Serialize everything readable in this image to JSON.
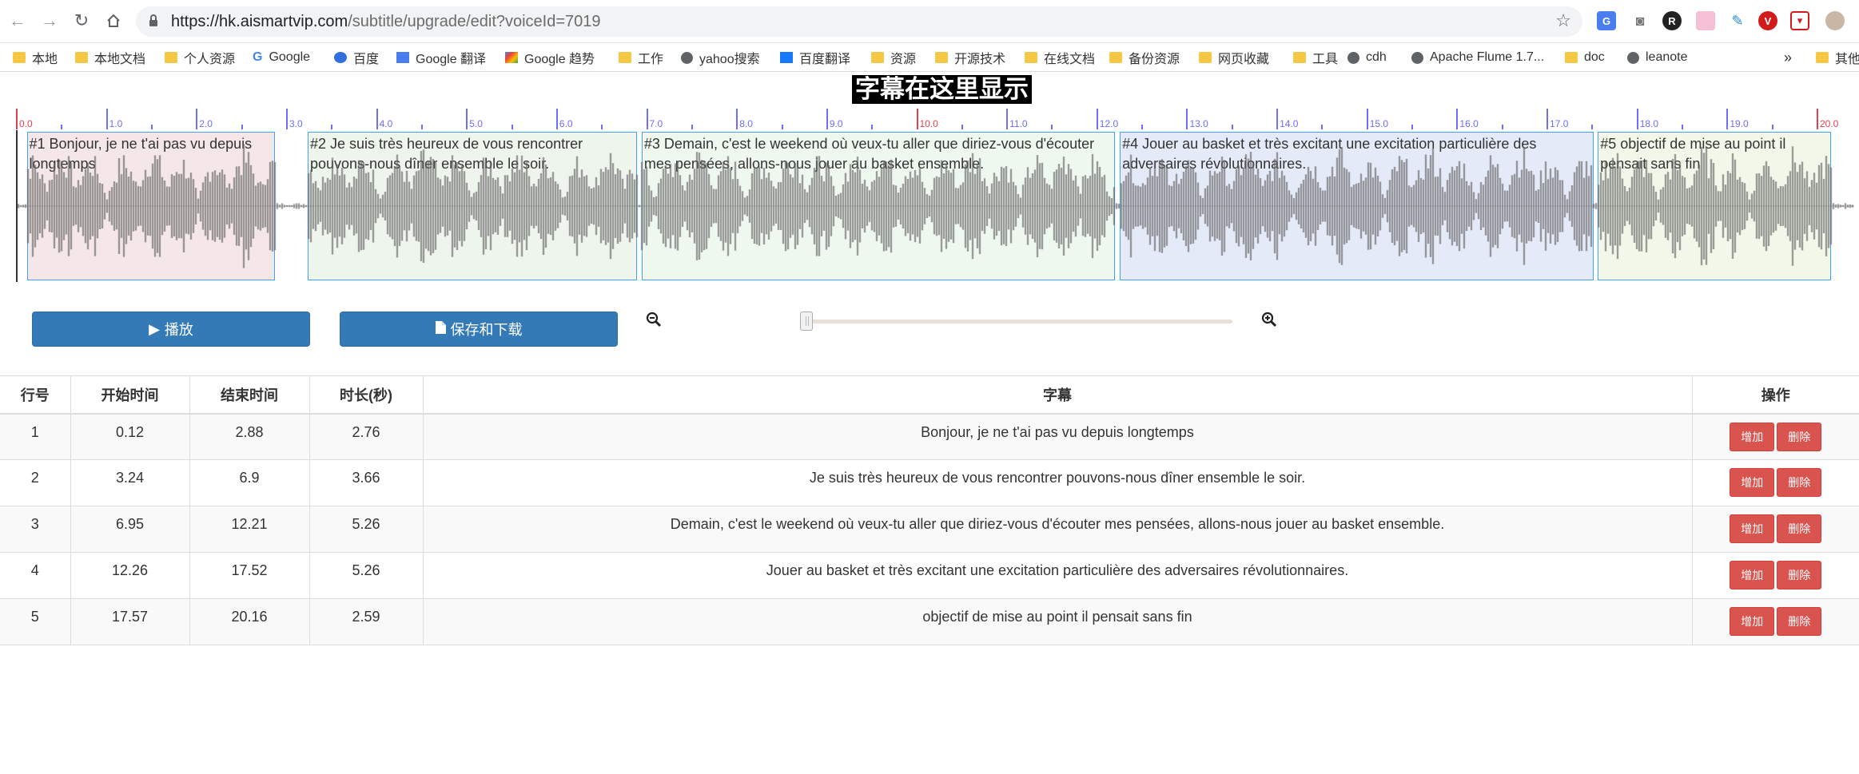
{
  "browser": {
    "url_host": "https://hk.aismartvip.com",
    "url_path": "/subtitle/upgrade/edit?voiceId=7019",
    "bookmarks": [
      {
        "label": "本地",
        "icon": "folder"
      },
      {
        "label": "本地文档",
        "icon": "folder"
      },
      {
        "label": "个人资源",
        "icon": "folder"
      },
      {
        "label": "Google",
        "icon": "google-icon"
      },
      {
        "label": "百度",
        "icon": "baidu-icon"
      },
      {
        "label": "Google 翻译",
        "icon": "translate-icon"
      },
      {
        "label": "Google 趋势",
        "icon": "trends-icon"
      },
      {
        "label": "工作",
        "icon": "folder"
      },
      {
        "label": "yahoo搜索",
        "icon": "globe"
      },
      {
        "label": "百度翻译",
        "icon": "baidu-translate-icon"
      },
      {
        "label": "资源",
        "icon": "folder"
      },
      {
        "label": "开源技术",
        "icon": "folder"
      },
      {
        "label": "在线文档",
        "icon": "folder"
      },
      {
        "label": "备份资源",
        "icon": "folder"
      },
      {
        "label": "网页收藏",
        "icon": "folder"
      },
      {
        "label": "工具",
        "icon": "folder"
      },
      {
        "label": "cdh",
        "icon": "globe"
      },
      {
        "label": "Apache Flume 1.7...",
        "icon": "globe"
      },
      {
        "label": "doc",
        "icon": "folder"
      },
      {
        "label": "leanote",
        "icon": "globe"
      }
    ],
    "overflow_label": "»",
    "other_bookmarks": "其他"
  },
  "player": {
    "subtitle_display": "字幕在这里显示",
    "ticks": [
      "0.0",
      "1.0",
      "2.0",
      "3.0",
      "4.0",
      "5.0",
      "6.0",
      "7.0",
      "8.0",
      "9.0",
      "10.0",
      "11.0",
      "12.0",
      "13.0",
      "14.0",
      "15.0",
      "16.0",
      "17.0",
      "18.0",
      "19.0",
      "20.0"
    ],
    "regions": [
      {
        "label": "#1 Bonjour, je ne t'ai pas vu depuis longtemps",
        "start": 0.12,
        "end": 2.88,
        "color": "#f5e7e7"
      },
      {
        "label": "#2 Je suis très heureux de vous rencontrer pouvons-nous dîner ensemble le soir.",
        "start": 3.24,
        "end": 6.9,
        "color": "#eef5ec"
      },
      {
        "label": "#3 Demain, c'est le weekend où veux-tu aller que diriez-vous d'écouter mes pensées, allons-nous jouer au basket ensemble.",
        "start": 6.95,
        "end": 12.21,
        "color": "#eff8ef"
      },
      {
        "label": "#4 Jouer au basket et très excitant une excitation particulière des adversaires révolutionnaires.",
        "start": 12.26,
        "end": 17.52,
        "color": "#e4eaf8"
      },
      {
        "label": "#5 objectif de mise au point il pensait sans fin",
        "start": 17.57,
        "end": 20.16,
        "color": "#f1f8e9"
      }
    ],
    "play_label": "播放",
    "save_label": "保存和下载",
    "zoom_level": 0.0
  },
  "table": {
    "headers": {
      "row": "行号",
      "start": "开始时间",
      "end": "结束时间",
      "duration": "时长(秒)",
      "subtitle": "字幕",
      "actions": "操作"
    },
    "rows": [
      {
        "no": "1",
        "start": "0.12",
        "end": "2.88",
        "dur": "2.76",
        "text": "Bonjour, je ne t'ai pas vu depuis longtemps"
      },
      {
        "no": "2",
        "start": "3.24",
        "end": "6.9",
        "dur": "3.66",
        "text": "Je suis très heureux de vous rencontrer pouvons-nous dîner ensemble le soir."
      },
      {
        "no": "3",
        "start": "6.95",
        "end": "12.21",
        "dur": "5.26",
        "text": "Demain, c'est le weekend où veux-tu aller que diriez-vous d'écouter mes pensées, allons-nous jouer au basket ensemble."
      },
      {
        "no": "4",
        "start": "12.26",
        "end": "17.52",
        "dur": "5.26",
        "text": "Jouer au basket et très excitant une excitation particulière des adversaires révolutionnaires."
      },
      {
        "no": "5",
        "start": "17.57",
        "end": "20.16",
        "dur": "2.59",
        "text": "objectif de mise au point il pensait sans fin"
      }
    ],
    "add_label": "增加",
    "delete_label": "删除"
  },
  "colors": {
    "primary": "#337ab7",
    "danger": "#d9534f",
    "tick": "#6d6dff",
    "tick_major": "#e53e4e",
    "region_border": "#3ba4ff"
  }
}
